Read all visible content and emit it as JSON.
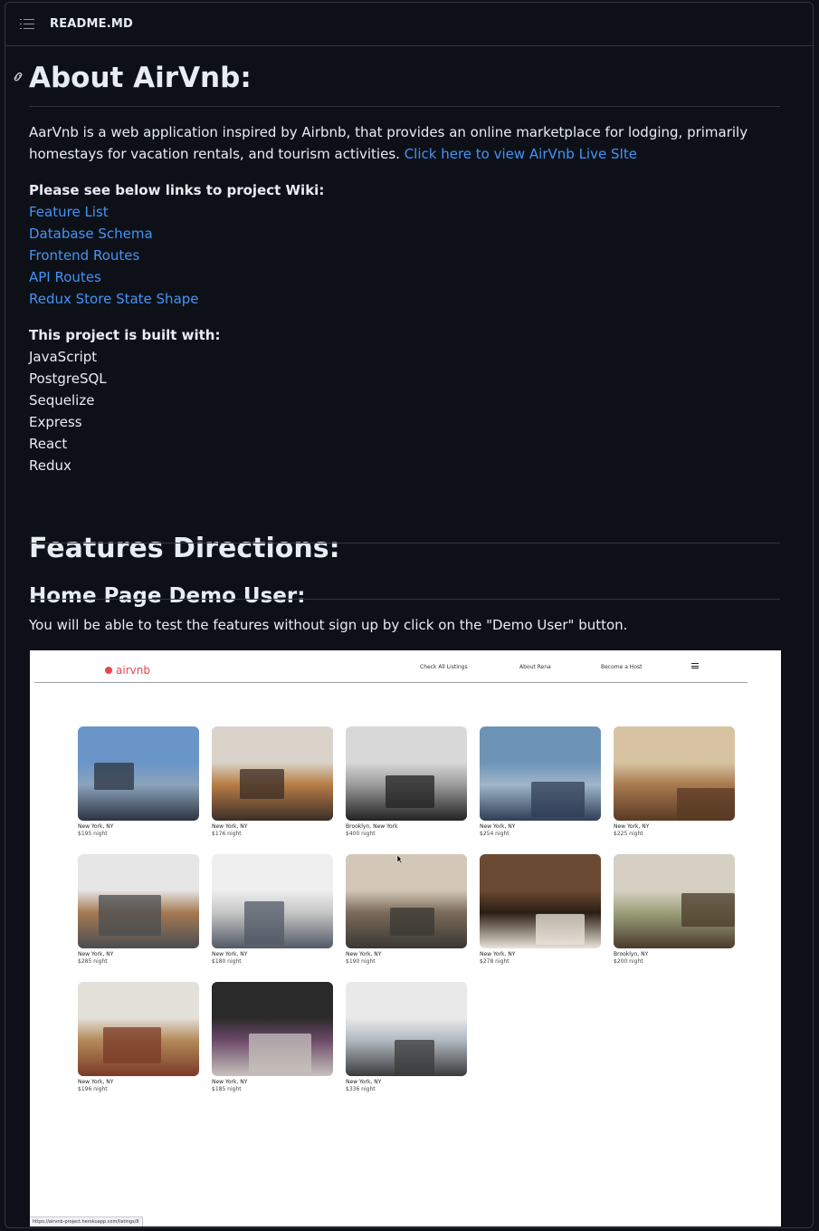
{
  "header": {
    "title": "README.MD",
    "icon": "list-icon"
  },
  "about": {
    "heading": "About AirVnb:",
    "intro": "AarVnb is a web application inspired by Airbnb, that provides an online marketplace for lodging, primarily homestays for vacation rentals, and tourism activities.",
    "live_link": "Click here to view AirVnb Live SIte",
    "wiki_heading": "Please see below links to project Wiki:",
    "wiki_links": [
      "Feature List",
      "Database Schema",
      "Frontend Routes",
      "API Routes",
      "Redux Store State Shape"
    ],
    "built_heading": "This project is built with:",
    "built_with": [
      "JavaScript",
      "PostgreSQL",
      "Sequelize",
      "Express",
      "React",
      "Redux"
    ]
  },
  "features": {
    "heading": "Features Directions:",
    "demo_heading": "Home Page Demo User:",
    "demo_text": "You will be able to test the features without sign up by click on the \"Demo User\" button."
  },
  "screenshot": {
    "logo": "airvnb",
    "nav": [
      "Check All Listings",
      "About Rena",
      "Become a Host"
    ],
    "status_url": "https://airvnb-project.herokuapp.com/listings/8",
    "listings": [
      {
        "city": "New York, NY",
        "price": "$195 night",
        "palette": [
          "#6a95c8",
          "#2c3440",
          "#8aa3bb"
        ]
      },
      {
        "city": "New York, NY",
        "price": "$176 night",
        "palette": [
          "#d9d3c9",
          "#3a2e28",
          "#b77c45"
        ]
      },
      {
        "city": "Brooklyn, New York",
        "price": "$400 night",
        "palette": [
          "#d8d8d8",
          "#222222",
          "#9a9a9a"
        ]
      },
      {
        "city": "New York, NY",
        "price": "$254 night",
        "palette": [
          "#6d94b7",
          "#2f3e55",
          "#9fb5c9"
        ]
      },
      {
        "city": "New York, NY",
        "price": "$225 night",
        "palette": [
          "#d7c3a1",
          "#5a3a24",
          "#a87a4f"
        ]
      },
      {
        "city": "New York, NY",
        "price": "$285 night",
        "palette": [
          "#e6e6e6",
          "#4a4d52",
          "#a57a52"
        ]
      },
      {
        "city": "New York, NY",
        "price": "$180 night",
        "palette": [
          "#efefef",
          "#525a66",
          "#c5c5c5"
        ]
      },
      {
        "city": "New York, NY",
        "price": "$190 night",
        "palette": [
          "#d3c8b8",
          "#3a3834",
          "#7a6b57"
        ]
      },
      {
        "city": "New York, NY",
        "price": "$278 night",
        "palette": [
          "#6a4a32",
          "#eae3d8",
          "#2a1d14"
        ]
      },
      {
        "city": "Brooklyn, NY",
        "price": "$200 night",
        "palette": [
          "#d6d0c4",
          "#4a3a2a",
          "#9aa07a"
        ]
      },
      {
        "city": "New York, NY",
        "price": "$196 night",
        "palette": [
          "#e4e0da",
          "#7a3a28",
          "#b38a5a"
        ]
      },
      {
        "city": "New York, NY",
        "price": "$185 night",
        "palette": [
          "#2a2a2a",
          "#c7c3bd",
          "#6d4a6a"
        ]
      },
      {
        "city": "New York, NY",
        "price": "$336 night",
        "palette": [
          "#e9e9e9",
          "#3b3b3b",
          "#b0b8c0"
        ]
      }
    ]
  },
  "colors": {
    "background": "#0d1117",
    "text": "#e6edf3",
    "link": "#4493f8",
    "border": "#30363d"
  }
}
